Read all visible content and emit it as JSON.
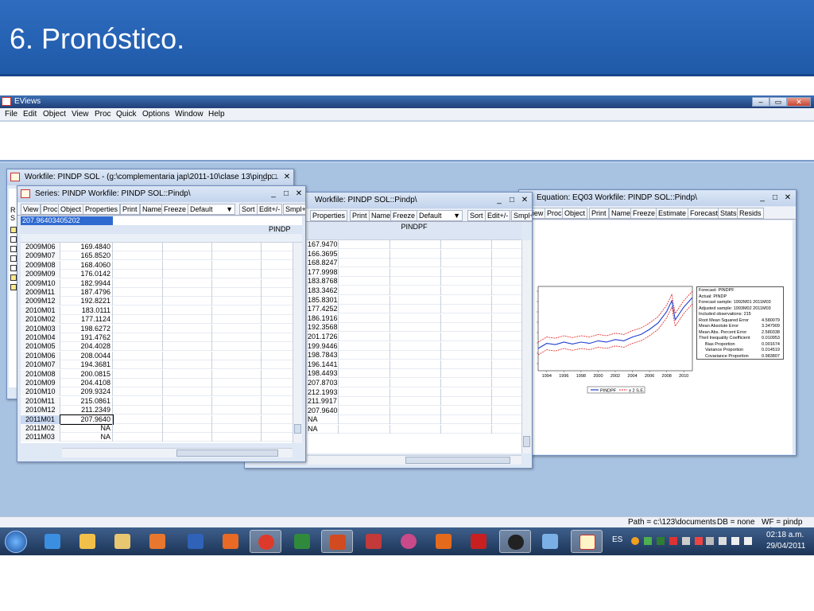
{
  "slide": {
    "title": "6. Pronóstico."
  },
  "app": {
    "title": "EViews",
    "menu": [
      "File",
      "Edit",
      "Object",
      "View",
      "Proc",
      "Quick",
      "Options",
      "Window",
      "Help"
    ]
  },
  "workfile_window": {
    "title": "Workfile: PINDP SOL - (g:\\complementaria jap\\2011-10\\clase 13\\pindp...",
    "side_letters": [
      "R",
      "S"
    ]
  },
  "series_window": {
    "title": "Series: PINDP   Workfile: PINDP SOL::Pindp\\",
    "toolbar": [
      "View",
      "Proc",
      "Object",
      "Properties",
      "Print",
      "Name",
      "Freeze",
      "Default",
      "Sort",
      "Edit+/-",
      "Smpl+"
    ],
    "edit_value": "207.96403405202",
    "column_header": "PINDP",
    "rows": [
      {
        "label": "2009M06",
        "value": "169.4840"
      },
      {
        "label": "2009M07",
        "value": "165.8520"
      },
      {
        "label": "2009M08",
        "value": "168.4060"
      },
      {
        "label": "2009M09",
        "value": "176.0142"
      },
      {
        "label": "2009M10",
        "value": "182.9944"
      },
      {
        "label": "2009M11",
        "value": "187.4796"
      },
      {
        "label": "2009M12",
        "value": "192.8221"
      },
      {
        "label": "2010M01",
        "value": "183.0111"
      },
      {
        "label": "2010M02",
        "value": "177.1124"
      },
      {
        "label": "2010M03",
        "value": "198.6272"
      },
      {
        "label": "2010M04",
        "value": "191.4762"
      },
      {
        "label": "2010M05",
        "value": "204.4028"
      },
      {
        "label": "2010M06",
        "value": "208.0044"
      },
      {
        "label": "2010M07",
        "value": "194.3681"
      },
      {
        "label": "2010M08",
        "value": "200.0815"
      },
      {
        "label": "2010M09",
        "value": "204.4108"
      },
      {
        "label": "2010M10",
        "value": "209.9324"
      },
      {
        "label": "2010M11",
        "value": "215.0861"
      },
      {
        "label": "2010M12",
        "value": "211.2349"
      },
      {
        "label": "2011M01",
        "value": "207.9640"
      },
      {
        "label": "2011M02",
        "value": "NA"
      },
      {
        "label": "2011M03",
        "value": "NA"
      }
    ]
  },
  "pindpf_window": {
    "title": "Workfile: PINDP SOL::Pindp\\",
    "toolbar": [
      "Properties",
      "Print",
      "Name",
      "Freeze",
      "Default",
      "Sort",
      "Edit+/-",
      "Smpl+"
    ],
    "column_header": "PINDPF",
    "values": [
      "167.9470",
      "166.3695",
      "168.8247",
      "177.9998",
      "183.8768",
      "183.3462",
      "185.8301",
      "177.4252",
      "186.1916",
      "192.3568",
      "201.1726",
      "199.9446",
      "198.7843",
      "196.1441",
      "198.4493",
      "207.8703",
      "212.1993",
      "211.9917",
      "207.9640",
      "NA",
      "NA"
    ]
  },
  "equation_window": {
    "title": "Equation: EQ03   Workfile: PINDP SOL::Pindp\\",
    "toolbar": [
      "View",
      "Proc",
      "Object",
      "Print",
      "Name",
      "Freeze",
      "Estimate",
      "Forecast",
      "Stats",
      "Resids"
    ],
    "forecast_stats": [
      "Forecast: PINDPF",
      "Actual: PINDP",
      "Forecast sample: 1992M01 2011M03",
      "Adjusted sample: 1993M02 2011M03",
      "Included observations: 215",
      "Root Mean Squared Error",
      "Mean Absolute Error",
      "Mean Abs. Percent Error",
      "Theil Inequality Coefficient",
      "Bias Proportion",
      "Variance Proportion",
      "Covariance Proportion"
    ],
    "forecast_values": [
      "4.580079",
      "3.347909",
      "2.580338",
      "0.010953",
      "0.001674",
      "0.014519",
      "0.983807"
    ],
    "legend": [
      "PINDPF",
      "± 2 S.E."
    ],
    "colors": {
      "forecast": "#1f3fd0",
      "bands": "#e02020"
    }
  },
  "chart_data": {
    "type": "line",
    "xlabel": "",
    "ylabel": "",
    "x_ticks": [
      "1994",
      "1996",
      "1998",
      "2000",
      "2002",
      "2004",
      "2006",
      "2008",
      "2010"
    ],
    "x_range": [
      1993,
      2011
    ],
    "series": [
      {
        "name": "PINDPF",
        "color": "#1f3fd0",
        "x": [
          1993,
          1994,
          1995,
          1996,
          1997,
          1998,
          1999,
          2000,
          2001,
          2002,
          2003,
          2004,
          2005,
          2006,
          2007,
          2008,
          2008.6,
          2009,
          2010,
          2011
        ],
        "y": [
          60,
          68,
          66,
          70,
          67,
          70,
          68,
          72,
          70,
          74,
          72,
          78,
          82,
          90,
          100,
          118,
          135,
          105,
          125,
          140
        ]
      },
      {
        "name": "± 2 S.E.",
        "color": "#e02020",
        "x": [
          1993,
          1994,
          1995,
          1996,
          1997,
          1998,
          1999,
          2000,
          2001,
          2002,
          2003,
          2004,
          2005,
          2006,
          2007,
          2008,
          2008.6,
          2009,
          2010,
          2011
        ],
        "y": [
          70,
          78,
          76,
          80,
          77,
          80,
          78,
          82,
          80,
          84,
          82,
          88,
          92,
          100,
          110,
          128,
          145,
          115,
          135,
          150
        ]
      },
      {
        "name": "± 2 S.E.",
        "color": "#e02020",
        "x": [
          1993,
          1994,
          1995,
          1996,
          1997,
          1998,
          1999,
          2000,
          2001,
          2002,
          2003,
          2004,
          2005,
          2006,
          2007,
          2008,
          2008.6,
          2009,
          2010,
          2011
        ],
        "y": [
          50,
          58,
          56,
          60,
          57,
          60,
          58,
          62,
          60,
          64,
          62,
          68,
          72,
          80,
          90,
          108,
          125,
          95,
          115,
          130
        ]
      }
    ]
  },
  "status": {
    "path": "Path = c:\\123\\documents",
    "db": "DB = none",
    "wf": "WF = pindp sol"
  },
  "taskbar": {
    "lang": "ES",
    "time": "02:18 a.m.",
    "date": "29/04/2011"
  }
}
